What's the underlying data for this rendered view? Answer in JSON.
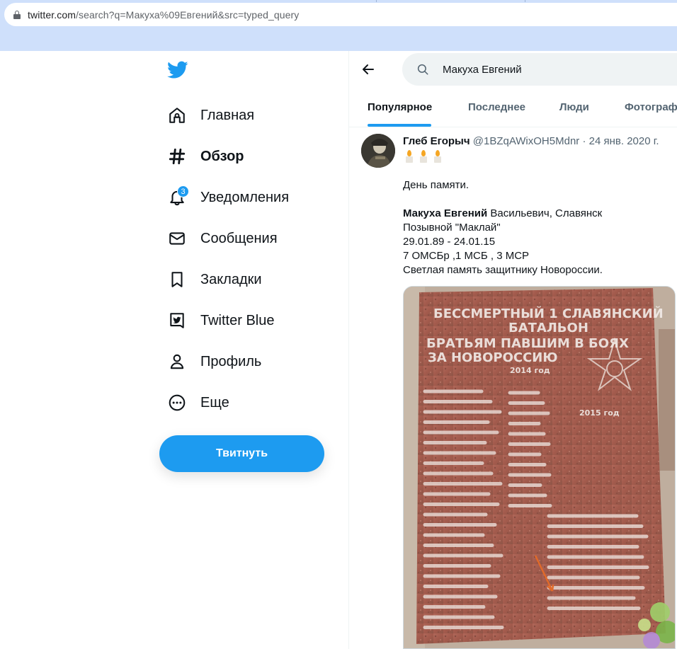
{
  "browser": {
    "url_host": "twitter.com",
    "url_path": "/search?q=Макуха%09Евгений&src=typed_query"
  },
  "nav": {
    "items": [
      {
        "label": "Главная",
        "icon": "home-icon"
      },
      {
        "label": "Обзор",
        "icon": "hashtag-icon",
        "active": true
      },
      {
        "label": "Уведомления",
        "icon": "bell-icon",
        "badge": "3"
      },
      {
        "label": "Сообщения",
        "icon": "envelope-icon"
      },
      {
        "label": "Закладки",
        "icon": "bookmark-icon"
      },
      {
        "label": "Twitter Blue",
        "icon": "twitter-blue-icon"
      },
      {
        "label": "Профиль",
        "icon": "person-icon"
      },
      {
        "label": "Еще",
        "icon": "more-circle-icon"
      }
    ],
    "tweet_button": "Твитнуть"
  },
  "search": {
    "query": "Макуха Евгений"
  },
  "tabs": [
    {
      "label": "Популярное",
      "active": true
    },
    {
      "label": "Последнее"
    },
    {
      "label": "Люди"
    },
    {
      "label": "Фотографии"
    }
  ],
  "tweet": {
    "author_name": "Глеб Егорыч",
    "handle": "@1BZqAWixOH5Mdnr",
    "separator": "·",
    "date": "24 янв. 2020 г.",
    "text_line1": "День памяти.",
    "name_bold": "Макуха Евгений",
    "name_rest": " Васильевич, Славянск",
    "text_line3": "Позывной \"Маклай\"",
    "text_line4": "29.01.89 - 24.01.15",
    "text_line5": "7 ОМСБр ,1 МСБ , 3 МСР",
    "text_line6": "Светлая память защитнику Новороссии."
  },
  "plaque": {
    "title1": "БЕССМЕРТНЫЙ 1 СЛАВЯНСКИЙ",
    "title2": "БАТАЛЬОН",
    "title3": "БРАТЬЯМ ПАВШИМ В БОЯХ",
    "title4": "ЗА НОВОРОССИЮ",
    "year1": "2014 год",
    "year2": "2015 год"
  },
  "colors": {
    "accent": "#1d9bf0",
    "chrome": "#cfe0fb",
    "text": "#0f1419",
    "secondary": "#536471"
  }
}
